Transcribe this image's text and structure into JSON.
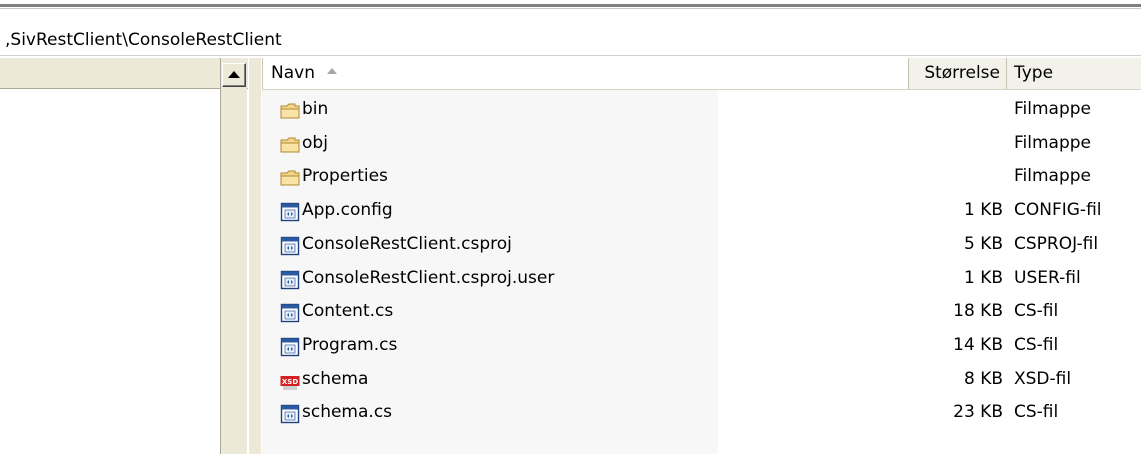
{
  "address": {
    "path": ",SivRestClient\\ConsoleRestClient"
  },
  "folder_pane": {
    "close_glyph": "✕"
  },
  "columns": {
    "name": "Navn",
    "size": "Størrelse",
    "type": "Type"
  },
  "files": [
    {
      "name": "bin",
      "size": "",
      "type": "Filmappe",
      "icon": "folder-icon"
    },
    {
      "name": "obj",
      "size": "",
      "type": "Filmappe",
      "icon": "folder-icon"
    },
    {
      "name": "Properties",
      "size": "",
      "type": "Filmappe",
      "icon": "folder-icon"
    },
    {
      "name": "App.config",
      "size": "1 KB",
      "type": "CONFIG-fil",
      "icon": "file-icon"
    },
    {
      "name": "ConsoleRestClient.csproj",
      "size": "5 KB",
      "type": "CSPROJ-fil",
      "icon": "file-icon"
    },
    {
      "name": "ConsoleRestClient.csproj.user",
      "size": "1 KB",
      "type": "USER-fil",
      "icon": "file-icon"
    },
    {
      "name": "Content.cs",
      "size": "18 KB",
      "type": "CS-fil",
      "icon": "file-icon"
    },
    {
      "name": "Program.cs",
      "size": "14 KB",
      "type": "CS-fil",
      "icon": "file-icon"
    },
    {
      "name": "schema",
      "size": "8 KB",
      "type": "XSD-fil",
      "icon": "xsd-icon"
    },
    {
      "name": "schema.cs",
      "size": "23 KB",
      "type": "CS-fil",
      "icon": "file-icon"
    }
  ],
  "colors": {
    "folder": "#f4d58c",
    "xsd": "#d42020",
    "chrome": "#ece9d8"
  }
}
